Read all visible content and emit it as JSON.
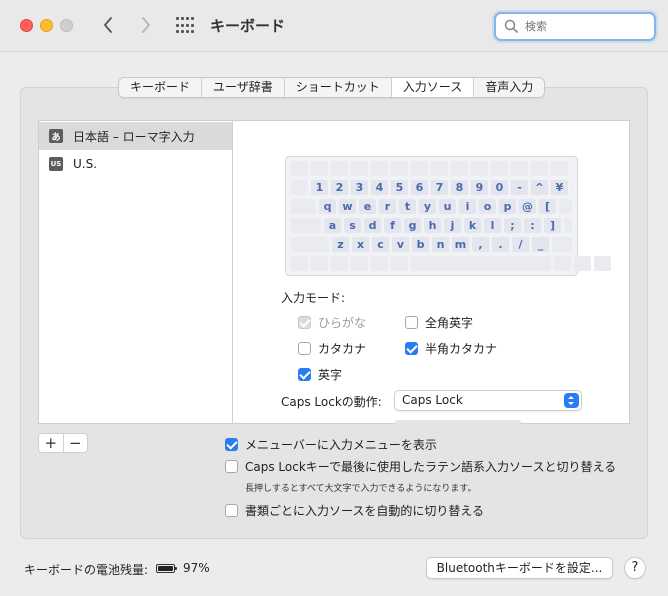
{
  "window": {
    "title": "キーボード",
    "search_placeholder": "検索"
  },
  "tabs": [
    {
      "label": "キーボード",
      "active": false
    },
    {
      "label": "ユーザ辞書",
      "active": false
    },
    {
      "label": "ショートカット",
      "active": false
    },
    {
      "label": "入力ソース",
      "active": true
    },
    {
      "label": "音声入力",
      "active": false
    }
  ],
  "sources": [
    {
      "icon": "あ",
      "label": "日本語 – ローマ字入力",
      "selected": true
    },
    {
      "icon": "US",
      "label": "U.S.",
      "selected": false
    }
  ],
  "keyboard_rows": [
    [
      "",
      "",
      "",
      "",
      "",
      "",
      "",
      "",
      "",
      "",
      "",
      "",
      "",
      ""
    ],
    [
      "1",
      "2",
      "3",
      "4",
      "5",
      "6",
      "7",
      "8",
      "9",
      "0",
      "-",
      "^",
      "¥"
    ],
    [
      "q",
      "w",
      "e",
      "r",
      "t",
      "y",
      "u",
      "i",
      "o",
      "p",
      "@",
      "["
    ],
    [
      "a",
      "s",
      "d",
      "f",
      "g",
      "h",
      "j",
      "k",
      "l",
      ";",
      ":",
      "]"
    ],
    [
      "z",
      "x",
      "c",
      "v",
      "b",
      "n",
      "m",
      ",",
      ".",
      "/",
      "_"
    ]
  ],
  "input_modes": {
    "label": "入力モード:",
    "items": [
      {
        "label": "ひらがな",
        "checked": true,
        "disabled": true
      },
      {
        "label": "全角英字",
        "checked": false,
        "disabled": false
      },
      {
        "label": "カタカナ",
        "checked": false,
        "disabled": false
      },
      {
        "label": "半角カタカナ",
        "checked": true,
        "disabled": false
      },
      {
        "label": "英字",
        "checked": true,
        "disabled": false
      }
    ]
  },
  "caps_lock": {
    "label": "Caps Lockの動作:",
    "value": "Caps Lock"
  },
  "list_controls": {
    "add": "+",
    "remove": "−"
  },
  "options": [
    {
      "label": "メニューバーに入力メニューを表示",
      "checked": true
    },
    {
      "label": "Caps Lockキーで最後に使用したラテン語系入力ソースと切り替える",
      "checked": false
    },
    {
      "label": "書類ごとに入力ソースを自動的に切り替える",
      "checked": false
    }
  ],
  "caps_note": "長押しするとすべて大文字で入力できるようになります。",
  "battery": {
    "label": "キーボードの電池残量:",
    "percent_text": "97%",
    "level": 0.97
  },
  "bluetooth_button": "Bluetoothキーボードを設定...",
  "help_button": "?",
  "colors": {
    "accent": "#2a7cf2",
    "key_text": "#4a6aa8"
  }
}
